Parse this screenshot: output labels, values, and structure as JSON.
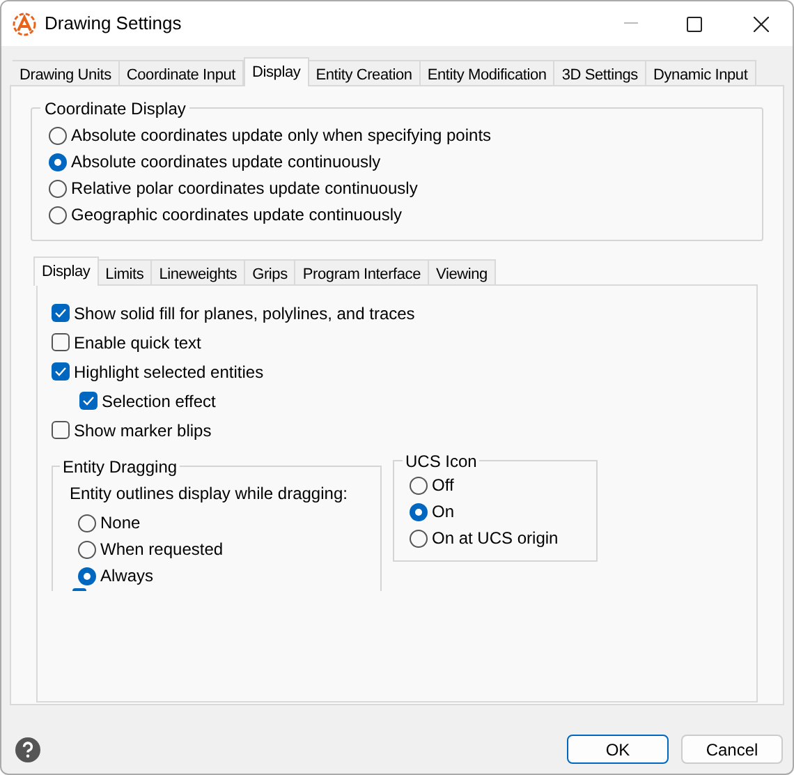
{
  "window": {
    "title": "Drawing Settings"
  },
  "tabs": [
    {
      "label": "Drawing Units",
      "selected": false
    },
    {
      "label": "Coordinate Input",
      "selected": false
    },
    {
      "label": "Display",
      "selected": true
    },
    {
      "label": "Entity Creation",
      "selected": false
    },
    {
      "label": "Entity Modification",
      "selected": false
    },
    {
      "label": "3D Settings",
      "selected": false
    },
    {
      "label": "Dynamic Input",
      "selected": false
    }
  ],
  "coordinate_display": {
    "title": "Coordinate Display",
    "options": [
      {
        "label": "Absolute coordinates update only when specifying points",
        "selected": false
      },
      {
        "label": "Absolute coordinates update continuously",
        "selected": true
      },
      {
        "label": "Relative polar coordinates update continuously",
        "selected": false
      },
      {
        "label": "Geographic coordinates update continuously",
        "selected": false
      }
    ]
  },
  "subtabs": [
    {
      "label": "Display",
      "selected": true
    },
    {
      "label": "Limits",
      "selected": false
    },
    {
      "label": "Lineweights",
      "selected": false
    },
    {
      "label": "Grips",
      "selected": false
    },
    {
      "label": "Program Interface",
      "selected": false
    },
    {
      "label": "Viewing",
      "selected": false
    }
  ],
  "checkboxes": [
    {
      "label": "Show solid fill for planes, polylines, and traces",
      "checked": true
    },
    {
      "label": "Enable quick text",
      "checked": false
    },
    {
      "label": "Highlight selected entities",
      "checked": true,
      "children": [
        {
          "label": "Selection effect",
          "checked": true
        }
      ]
    },
    {
      "label": "Show marker blips",
      "checked": false
    }
  ],
  "entity_dragging": {
    "title": "Entity Dragging",
    "prompt": "Entity outlines display while dragging:",
    "options": [
      {
        "label": "None",
        "selected": false
      },
      {
        "label": "When requested",
        "selected": false
      },
      {
        "label": "Always",
        "selected": true
      }
    ],
    "clipped_checkbox": {
      "checked": true
    }
  },
  "ucs_icon": {
    "title": "UCS Icon",
    "options": [
      {
        "label": "Off",
        "selected": false
      },
      {
        "label": "On",
        "selected": true
      },
      {
        "label": "On at UCS origin",
        "selected": false
      }
    ]
  },
  "buttons": [
    {
      "label": "OK",
      "kind": "default"
    },
    {
      "label": "Cancel",
      "kind": "normal"
    }
  ]
}
